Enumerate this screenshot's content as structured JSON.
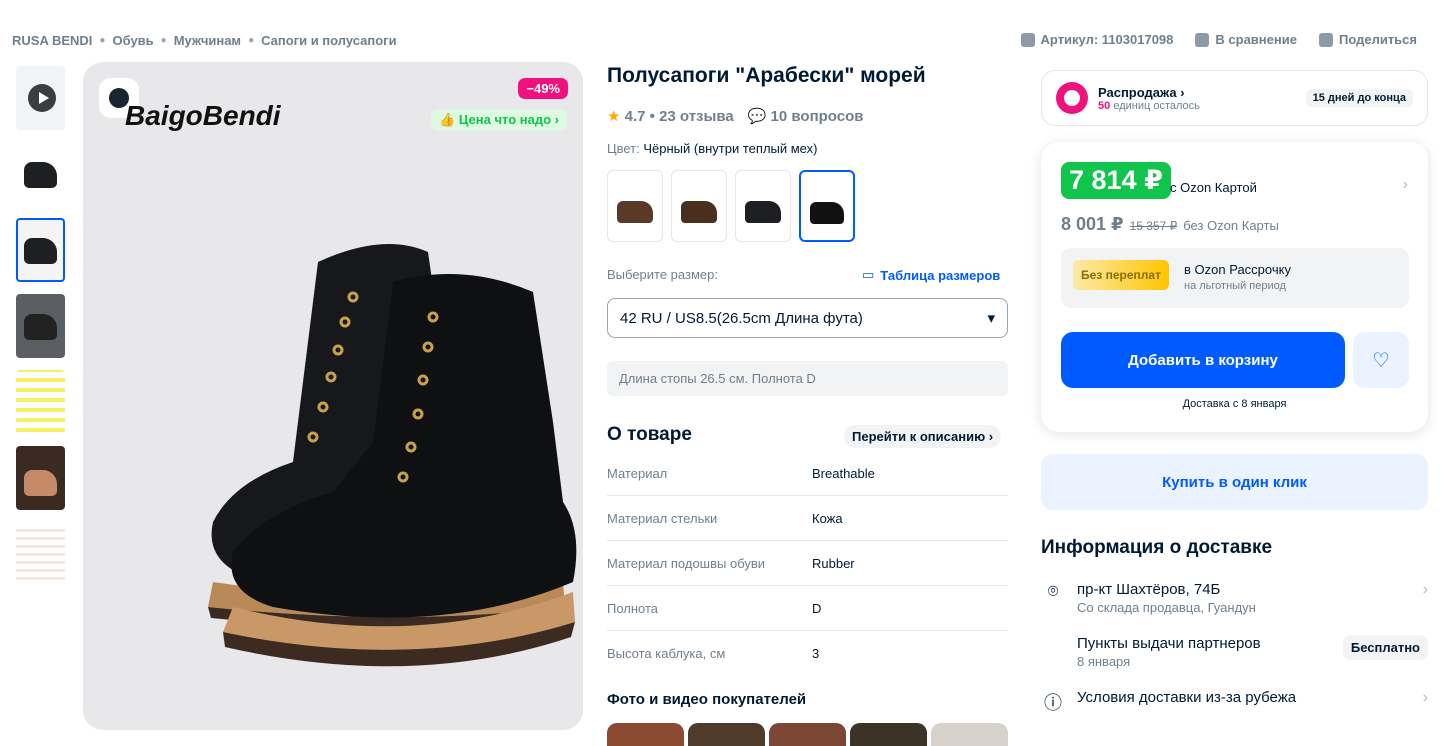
{
  "breadcrumbs": [
    "RUSA BENDI",
    "Обувь",
    "Мужчинам",
    "Сапоги и полусапоги"
  ],
  "top_links": {
    "article": "Артикул: 1103017098",
    "compare": "В сравнение",
    "share": "Поделиться"
  },
  "gallery": {
    "brand_text": "BaigoBendi",
    "discount": "−49%",
    "price_tag": "Цена что надо"
  },
  "product": {
    "title": "Полусапоги \"Арабески\" морей",
    "rating": "4.7 • 23 отзыва",
    "questions": "10 вопросов",
    "color_label": "Цвет:",
    "color_value": "Чёрный (внутри теплый мех)",
    "size_label": "Выберите размер:",
    "size_table": "Таблица размеров",
    "size_selected": "42 RU / US8.5(26.5cm Длина фута)",
    "size_hint": "Длина стопы 26.5 см. Полнота D"
  },
  "about": {
    "title": "О товаре",
    "goto": "Перейти к описанию",
    "specs": [
      {
        "k": "Материал",
        "v": "Breathable"
      },
      {
        "k": "Материал стельки",
        "v": "Кожа"
      },
      {
        "k": "Материал подошвы обуви",
        "v": "Rubber"
      },
      {
        "k": "Полнота",
        "v": "D"
      },
      {
        "k": "Высота каблука, см",
        "v": "3"
      }
    ],
    "photos_title": "Фото и видео покупателей"
  },
  "sale": {
    "title": "Распродажа",
    "count": "50",
    "left_text": "единиц осталось",
    "days": "15 дней до конца"
  },
  "price": {
    "ozon_card_price": "7 814 ₽",
    "ozon_card_label": "с Ozon Картой",
    "regular_price": "8 001 ₽",
    "old_price": "15 357 ₽",
    "regular_label": "без Ozon Карты",
    "installment_badge": "Без переплат",
    "installment_title": "в Ozon Рассрочку",
    "installment_sub": "на льготный период",
    "add_to_cart": "Добавить в корзину",
    "delivery": "Доставка с 8 января"
  },
  "one_click": "Купить в один клик",
  "delivery_info": {
    "title": "Информация о доставке",
    "address": "пр-кт Шахтёров, 74Б",
    "address_sub": "Со склада продавца, Гуандун",
    "pickup": "Пункты выдачи партнеров",
    "pickup_date": "8 января",
    "pickup_price": "Бесплатно",
    "abroad": "Условия доставки из-за рубежа"
  },
  "colors": {
    "accent": "#005bff",
    "green": "#10c44c",
    "pink": "#f1117e"
  }
}
